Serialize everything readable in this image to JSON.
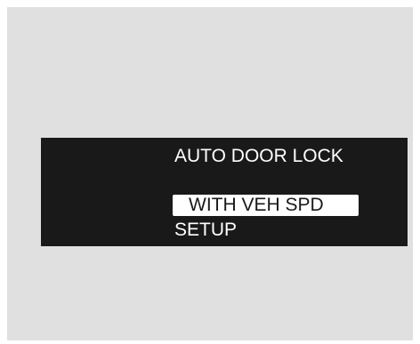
{
  "display": {
    "title": "AUTO DOOR LOCK",
    "options": [
      {
        "label": "WITH VEH SPD",
        "selected": true
      },
      {
        "label": "SETUP",
        "selected": false
      }
    ]
  },
  "colors": {
    "background": "#e0e0e0",
    "screen": "#191919",
    "text": "#ffffff",
    "highlight": "#ffffff",
    "highlight_text": "#191919"
  }
}
